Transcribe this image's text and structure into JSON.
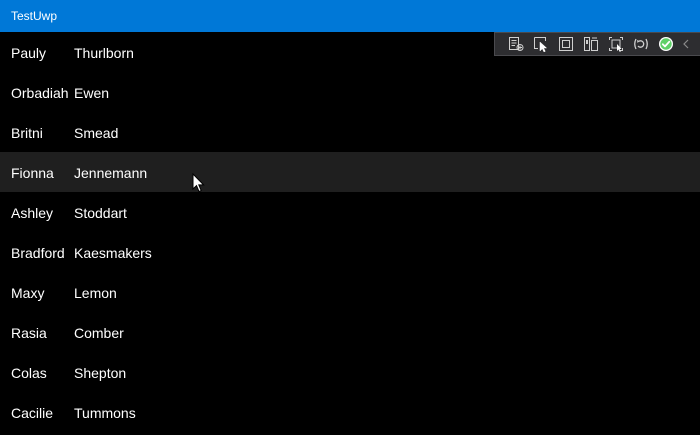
{
  "window": {
    "title": "TestUwp"
  },
  "people": [
    {
      "first": "Pauly",
      "last": "Thurlborn"
    },
    {
      "first": "Orbadiah",
      "last": "Ewen"
    },
    {
      "first": "Britni",
      "last": "Smead"
    },
    {
      "first": "Fionna",
      "last": "Jennemann"
    },
    {
      "first": "Ashley",
      "last": "Stoddart"
    },
    {
      "first": "Bradford",
      "last": "Kaesmakers"
    },
    {
      "first": "Maxy",
      "last": "Lemon"
    },
    {
      "first": "Rasia",
      "last": "Comber"
    },
    {
      "first": "Colas",
      "last": "Shepton"
    },
    {
      "first": "Cacilie",
      "last": "Tummons"
    }
  ],
  "debug_toolbar": {
    "icons": [
      "live-visual-tree-icon",
      "select-element-icon",
      "display-layout-adorners-icon",
      "track-focus-icon",
      "display-layout-icon",
      "hot-reload-icon",
      "accessibility-check-icon",
      "collapse-chevron-icon"
    ],
    "background": "#2d2d30",
    "status_color": "#5fd068"
  },
  "colors": {
    "titlebar": "#0078d7",
    "background": "#000000",
    "hover_row": "#1f1f1f"
  }
}
